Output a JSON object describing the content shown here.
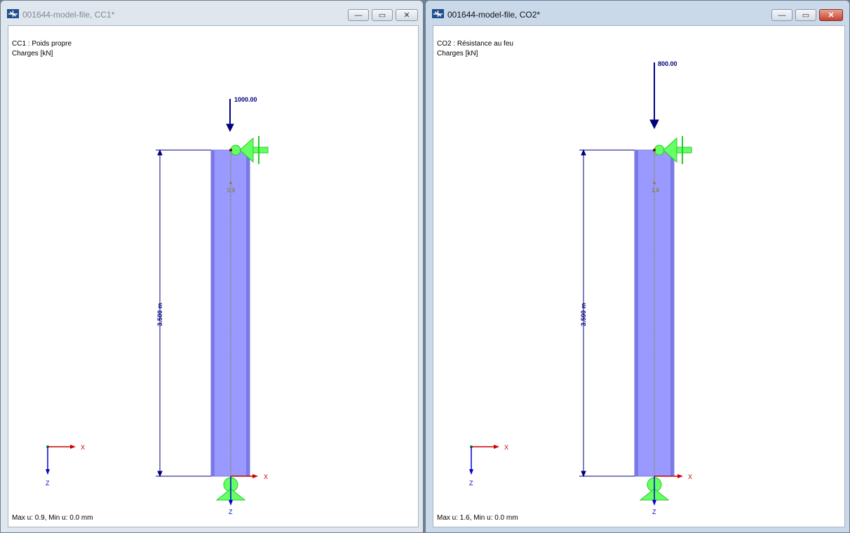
{
  "left_window": {
    "title": "001644-model-file, CC1*",
    "controls": {
      "minimize": "—",
      "restore": "▭",
      "close": "✕"
    },
    "load_case": "CC1 : Poids propre",
    "units": "Charges [kN]",
    "load_value": "1000.00",
    "dimension": "3.500 m",
    "deformation_label": "0.9",
    "axis_x": "X",
    "axis_z": "Z",
    "member_x": "X",
    "member_z": "Z",
    "status": "Max u: 0.9, Min u: 0.0 mm"
  },
  "right_window": {
    "title": "001644-model-file, CO2*",
    "controls": {
      "minimize": "—",
      "restore": "▭",
      "close": "✕"
    },
    "load_case": "CO2 : Résistance au feu",
    "units": "Charges [kN]",
    "load_value": "800.00",
    "dimension": "3.500 m",
    "deformation_label": "1.6",
    "axis_x": "X",
    "axis_z": "Z",
    "member_x": "X",
    "member_z": "Z",
    "status": "Max u: 1.6, Min u: 0.0 mm"
  },
  "colors": {
    "member_fill": "#9999ff",
    "member_edge": "#7a7ae6",
    "load_arrow": "#00007f",
    "support": "#66ff66",
    "axis_x": "#cc0000",
    "axis_z": "#0000cc",
    "dimension": "#00007f"
  },
  "icons": [
    "app-icon",
    "minimize-icon",
    "restore-icon",
    "close-icon"
  ]
}
